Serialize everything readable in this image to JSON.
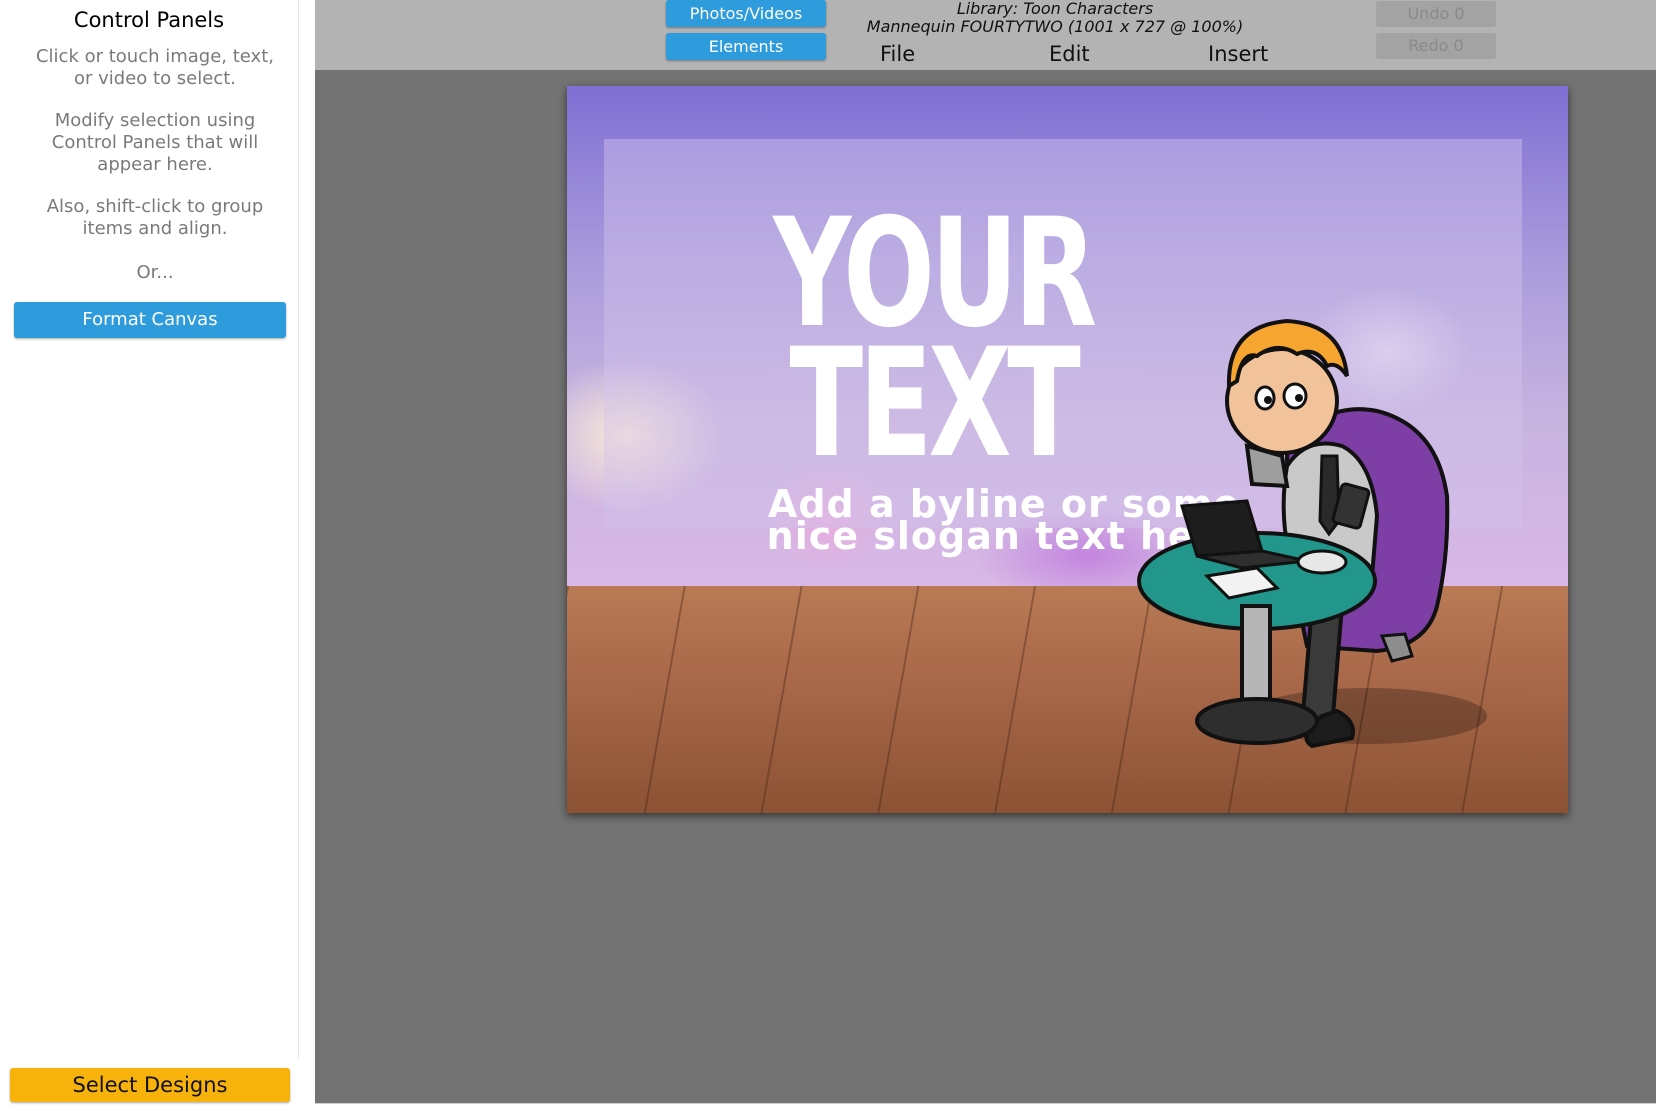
{
  "left_panel": {
    "title": "Control Panels",
    "help_select": "Click or touch image, text, or video to select.",
    "help_modify": "Modify selection using Control Panels that will appear here.",
    "help_shift": "Also, shift-click to group items and align.",
    "or_text": "Or...",
    "format_canvas_label": "Format Canvas",
    "select_designs_label": "Select Designs"
  },
  "toolbar": {
    "photos_videos_label": "Photos/Videos",
    "elements_label": "Elements",
    "library_line": "Library: Toon Characters",
    "item_line": "Mannequin FOURTYTWO (1001 x 727 @ 100%)",
    "menu": [
      "File",
      "Edit",
      "Insert"
    ],
    "undo_label": "Undo 0",
    "redo_label": "Redo 0"
  },
  "canvas": {
    "headline_line1": "YOUR",
    "headline_line2": "TEXT",
    "byline": "Add a byline or some nice slogan text here"
  },
  "colors": {
    "accent_blue": "#2d9bdc",
    "select_designs": "#f7b30c",
    "workspace": "#737373",
    "toolbar": "#b3b3b3"
  }
}
